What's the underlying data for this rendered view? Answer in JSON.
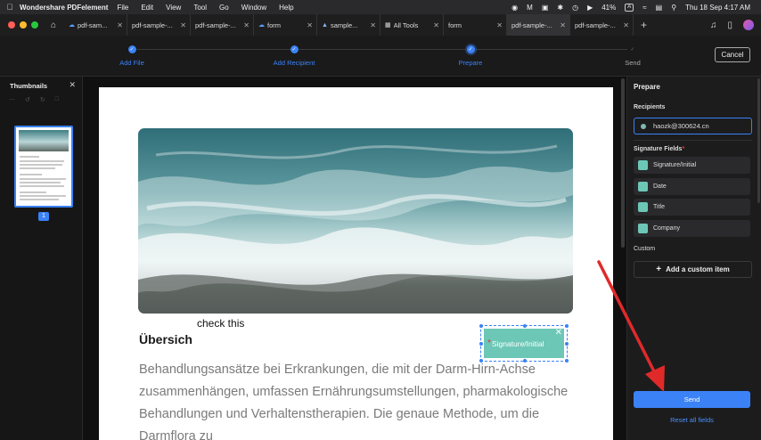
{
  "menubar": {
    "app_name": "Wondershare PDFelement",
    "items": [
      "File",
      "Edit",
      "View",
      "Tool",
      "Go",
      "Window",
      "Help"
    ],
    "battery": "41%",
    "datetime": "Thu 18 Sep  4:17 AM",
    "status_letter": "A"
  },
  "tabs": [
    {
      "label": "pdf-sam...",
      "icon": "cloud-icon",
      "active": false
    },
    {
      "label": "pdf-sample-...",
      "icon": "",
      "active": false
    },
    {
      "label": "pdf-sample-...",
      "icon": "",
      "active": false
    },
    {
      "label": "form",
      "icon": "cloud-icon",
      "active": false
    },
    {
      "label": "sample...",
      "icon": "chart-icon",
      "active": false
    },
    {
      "label": "All Tools",
      "icon": "grid-icon",
      "active": false
    },
    {
      "label": "form",
      "icon": "",
      "active": false
    },
    {
      "label": "pdf-sample-...",
      "icon": "",
      "active": true
    },
    {
      "label": "pdf-sample-...",
      "icon": "",
      "active": false
    }
  ],
  "steps": [
    {
      "label": "Add File",
      "state": "done"
    },
    {
      "label": "Add Recipient",
      "state": "done"
    },
    {
      "label": "Prepare",
      "state": "current"
    },
    {
      "label": "Send",
      "state": "pending"
    }
  ],
  "cancel_label": "Cancel",
  "thumbnails": {
    "title": "Thumbnails",
    "page_number": "1"
  },
  "document": {
    "check_text": "check this",
    "heading": "Übersich",
    "paragraph": "Behandlungsansätze bei Erkrankungen, die mit der Darm-Hirn-Achse zusammenhängen, umfassen Ernährungsumstellungen, pharmakologische Behandlungen und Verhaltenstherapien. Die genaue Methode, um die Darmflora zu",
    "signature_field_label": "Signature/Initial"
  },
  "prepare": {
    "title": "Prepare",
    "recipients_label": "Recipients",
    "recipient_email": "haozk@300624.cn",
    "signature_fields_label": "Signature Fields",
    "fields": [
      "Signature/Initial",
      "Date",
      "Title",
      "Company"
    ],
    "custom_label": "Custom",
    "add_custom_label": "Add a custom item",
    "send_label": "Send",
    "reset_label": "Reset all fields"
  },
  "colors": {
    "accent": "#3b82f6",
    "field_swatch": "#6cc7b6",
    "annotation_arrow": "#e02a2a"
  }
}
